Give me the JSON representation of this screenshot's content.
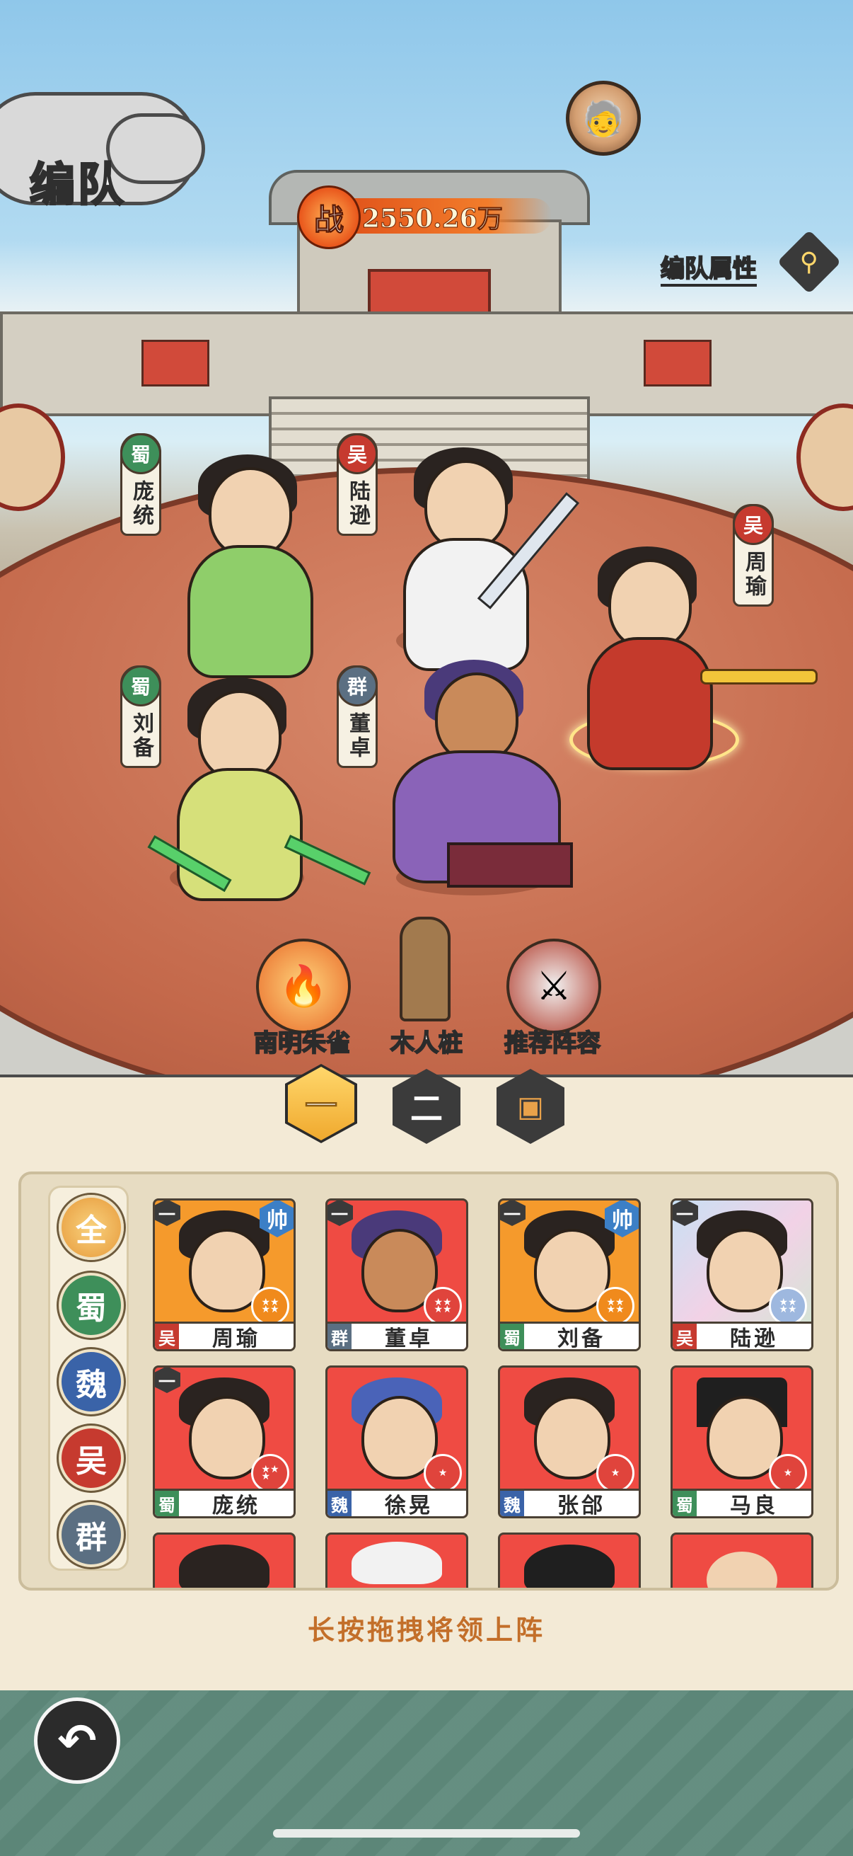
{
  "screen": {
    "title": "编队"
  },
  "power": {
    "badge": "战",
    "value": "2550.26万"
  },
  "header": {
    "formation_attr_label": "编队属性",
    "formation_attr_icon": "magnifier-icon",
    "avatar_icon": "player-avatar"
  },
  "formation": [
    {
      "faction": "蜀",
      "name": "庞统",
      "faction_color": "#3e8f5a"
    },
    {
      "faction": "吴",
      "name": "陆逊",
      "faction_color": "#c63a2f"
    },
    {
      "faction": "吴",
      "name": "周瑜",
      "faction_color": "#c63a2f"
    },
    {
      "faction": "蜀",
      "name": "刘备",
      "faction_color": "#3e8f5a"
    },
    {
      "faction": "群",
      "name": "董卓",
      "faction_color": "#5b6f82"
    }
  ],
  "tools": [
    {
      "label": "南明朱雀",
      "icon": "phoenix-icon"
    },
    {
      "label": "木人桩",
      "icon": "wooden-dummy-icon"
    },
    {
      "label": "推荐阵容",
      "icon": "crossed-swords-icon"
    }
  ],
  "team_tabs": [
    {
      "label": "一",
      "active": true
    },
    {
      "label": "二",
      "active": false
    },
    {
      "label": "",
      "icon": "lock-chest-icon",
      "active": false
    }
  ],
  "filters": [
    {
      "label": "全",
      "color": "#e79a3b",
      "active": true
    },
    {
      "label": "蜀",
      "color": "#3e8f5a"
    },
    {
      "label": "魏",
      "color": "#3a63a8"
    },
    {
      "label": "吴",
      "color": "#c63a2f"
    },
    {
      "label": "群",
      "color": "#5b6f82"
    }
  ],
  "roster": [
    {
      "name": "周瑜",
      "faction": "吴",
      "team": "一",
      "leader": "帅",
      "bg": "#f59a2c",
      "star_color": "#f08a1c",
      "stars": 4
    },
    {
      "name": "董卓",
      "faction": "群",
      "team": "一",
      "leader": "",
      "bg": "#ef4b43",
      "star_color": "#e0443c",
      "stars": 4
    },
    {
      "name": "刘备",
      "faction": "蜀",
      "team": "一",
      "leader": "帅",
      "bg": "#f59a2c",
      "star_color": "#f08a1c",
      "stars": 4
    },
    {
      "name": "陆逊",
      "faction": "吴",
      "team": "一",
      "leader": "",
      "bg": "#b7cde8",
      "star_color": "#9eb8df",
      "stars": 4
    },
    {
      "name": "庞统",
      "faction": "蜀",
      "team": "一",
      "leader": "",
      "bg": "#ef4b43",
      "star_color": "#e0443c",
      "stars": 3
    },
    {
      "name": "徐晃",
      "faction": "魏",
      "team": "",
      "leader": "",
      "bg": "#ef4b43",
      "star_color": "#e0443c",
      "stars": 1
    },
    {
      "name": "张郃",
      "faction": "魏",
      "team": "",
      "leader": "",
      "bg": "#ef4b43",
      "star_color": "#e0443c",
      "stars": 1
    },
    {
      "name": "马良",
      "faction": "蜀",
      "team": "",
      "leader": "",
      "bg": "#ef4b43",
      "star_color": "#e0443c",
      "stars": 1
    }
  ],
  "hint": "长按拖拽将领上阵",
  "footer": {
    "back_icon": "back-arrow-icon"
  },
  "colors": {
    "shu": "#3e8f5a",
    "wu": "#c63a2f",
    "wei": "#3a63a8",
    "qun": "#5b6f82",
    "hint": "#c36f2a"
  }
}
